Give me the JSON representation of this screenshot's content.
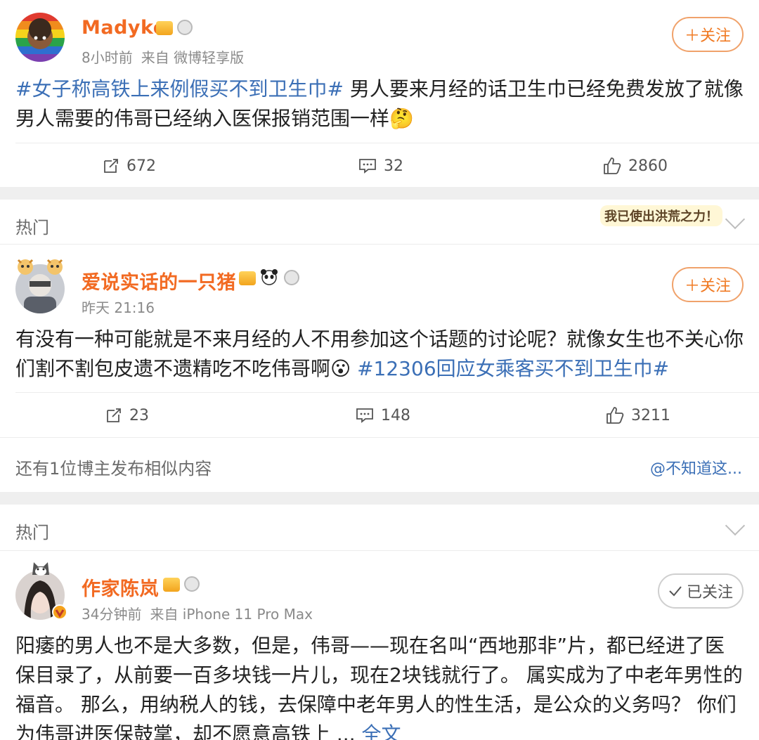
{
  "posts": [
    {
      "user_name": "Madyke",
      "time": "8小时前",
      "source": "来自 微博轻享版",
      "follow_label": "＋关注",
      "hashtag": "#女子称高铁上来例假买不到卫生巾#",
      "text_after_tag": " 男人要来月经的话卫生巾已经免费发放了就像男人需要的伟哥已经纳入医保报销范围一样🤔",
      "reposts": "672",
      "comments": "32",
      "likes": "2860"
    },
    {
      "user_name": "爱说实话的一只猪",
      "time": "昨天 21:16",
      "follow_label": "＋关注",
      "text_before_tag": "有没有一种可能就是不来月经的人不用参加这个话题的讨论呢？就像女生也不关心你们割不割包皮遗不遗精吃不吃伟哥啊😮 ",
      "hashtag": "#12306回应女乘客买不到卫生巾#",
      "reposts": "23",
      "comments": "148",
      "likes": "3211",
      "similar_left": "还有1位博主发布相似内容",
      "similar_right": "@不知道这..."
    },
    {
      "user_name": "作家陈岚",
      "time": "34分钟前",
      "source": "来自 iPhone 11 Pro Max",
      "follow_label": "已关注",
      "text": " 阳痿的男人也不是大多数，但是，伟哥——现在名叫“西地那非”片，都已经进了医保目录了，从前要一百多块钱一片儿，现在2块钱就行了。 属实成为了中老年男性的福音。 那么，用纳税人的钱，去保障中老年男人的性生活，是公众的义务吗？ 你们为伟哥进医保鼓掌，却不愿意高铁上 ...",
      "more_label": "全文"
    }
  ],
  "hot_label": "热门",
  "sticker_text": "我已使出洪荒之力！",
  "colors": {
    "name": "#f26a22",
    "link": "#3b6fb6",
    "separator": "#efefef"
  },
  "icons": [
    "repost-icon",
    "comment-icon",
    "like-icon",
    "chevron-down-icon",
    "crown-badge-icon",
    "medal-badge-icon",
    "panda-icon",
    "check-icon",
    "verified-icon"
  ]
}
